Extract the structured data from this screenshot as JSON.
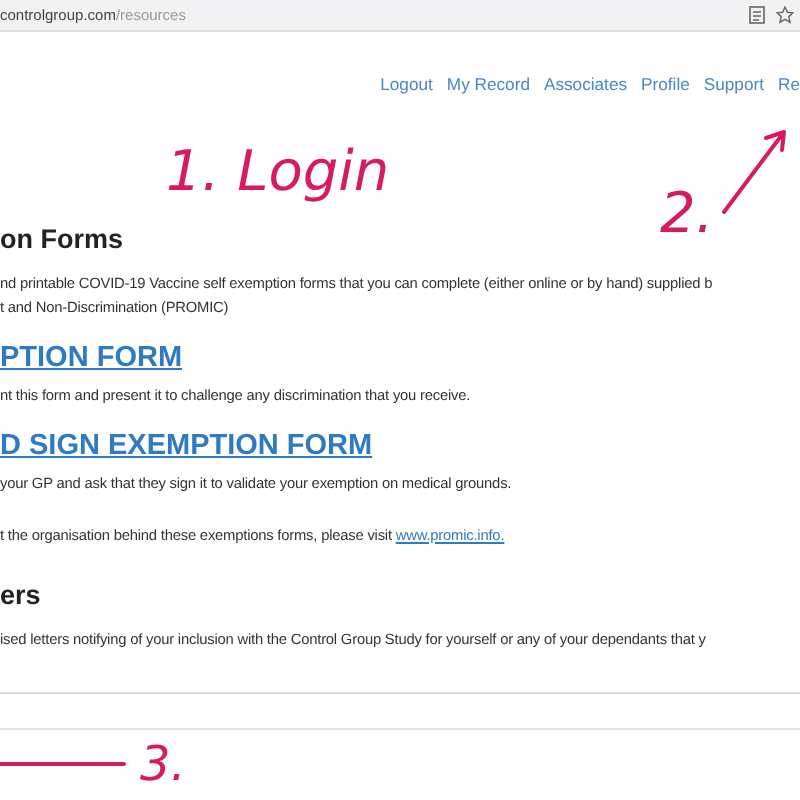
{
  "browser": {
    "url_host": "controlgroup.com",
    "url_path": "/resources"
  },
  "nav": [
    "Logout",
    "My Record",
    "Associates",
    "Profile",
    "Support",
    "Re"
  ],
  "sections": [
    {
      "kind": "heading",
      "text": "on Forms"
    },
    {
      "kind": "paragraph",
      "lines": [
        "nd printable COVID-19 Vaccine self exemption forms that you can complete (either online or by hand) supplied b",
        "t and Non-Discrimination (PROMIC)"
      ]
    },
    {
      "kind": "link-heading",
      "text": "PTION FORM"
    },
    {
      "kind": "paragraph",
      "lines": [
        "nt this form and present it to challenge any discrimination that you receive."
      ]
    },
    {
      "kind": "link-heading",
      "text": "D SIGN EXEMPTION FORM"
    },
    {
      "kind": "paragraph",
      "lines": [
        "your GP and ask that they sign it to validate your exemption on medical grounds."
      ]
    },
    {
      "kind": "link-paragraph",
      "text": "t the organisation behind these exemptions forms, please visit",
      "link": "www.promic.info."
    },
    {
      "kind": "heading",
      "text": "ers"
    },
    {
      "kind": "paragraph",
      "lines": [
        "ised letters notifying of your inclusion with the Control Group Study for yourself or any of your dependants that y"
      ]
    }
  ],
  "annotations": {
    "step1": "1. Login",
    "step2": "2.",
    "step3": "3."
  }
}
